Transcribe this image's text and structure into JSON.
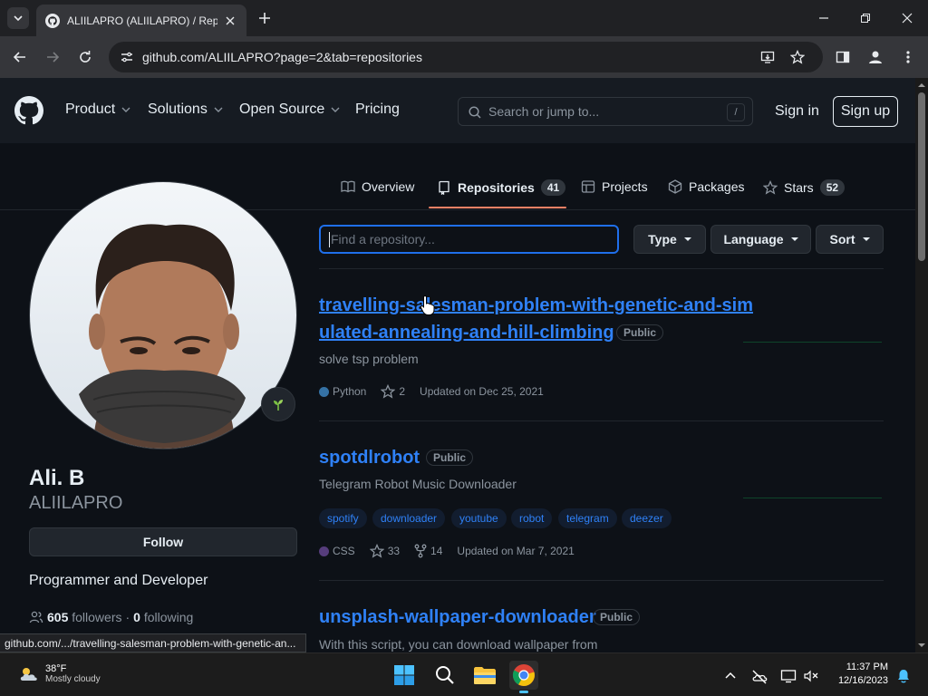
{
  "browser": {
    "tab_title": "ALIILAPRO (ALIILAPRO) / Repos",
    "url": "github.com/ALIILAPRO?page=2&tab=repositories",
    "status_url": "github.com/.../travelling-salesman-problem-with-genetic-an..."
  },
  "header": {
    "nav": [
      {
        "label": "Product"
      },
      {
        "label": "Solutions"
      },
      {
        "label": "Open Source"
      },
      {
        "label": "Pricing"
      }
    ],
    "search_placeholder": "Search or jump to...",
    "search_shortcut": "/",
    "signin": "Sign in",
    "signup": "Sign up"
  },
  "profile_tabs": {
    "overview": "Overview",
    "repositories": "Repositories",
    "repositories_count": "41",
    "projects": "Projects",
    "packages": "Packages",
    "stars": "Stars",
    "stars_count": "52"
  },
  "profile": {
    "name": "Ali. B",
    "login": "ALIILAPRO",
    "follow_label": "Follow",
    "bio": "Programmer and Developer",
    "followers_count": "605",
    "followers_label": "followers",
    "separator": "·",
    "following_count": "0",
    "following_label": "following"
  },
  "filters": {
    "find_placeholder": "Find a repository...",
    "type": "Type",
    "language": "Language",
    "sort": "Sort"
  },
  "repos": [
    {
      "name_line1": "travelling-salesman-problem-with-genetic-and-sim",
      "name_line2": "ulated-annealing-and-hill-climbing",
      "visibility": "Public",
      "description": "solve tsp problem",
      "language": "Python",
      "language_color": "#3572A5",
      "stars": "2",
      "updated": "Updated on Dec 25, 2021"
    },
    {
      "name": "spotdlrobot",
      "visibility": "Public",
      "description": "Telegram Robot Music Downloader",
      "topics": [
        "spotify",
        "downloader",
        "youtube",
        "robot",
        "telegram",
        "deezer"
      ],
      "language": "CSS",
      "language_color": "#563d7c",
      "stars": "33",
      "forks": "14",
      "updated": "Updated on Mar 7, 2021"
    },
    {
      "name": "unsplash-wallpaper-downloader",
      "visibility": "Public",
      "description": "With this script, you can download wallpaper from"
    }
  ],
  "taskbar": {
    "weather_temp": "38°F",
    "weather_desc": "Mostly cloudy",
    "time": "11:37 PM",
    "date": "12/16/2023"
  },
  "colors": {
    "link": "#2f81f7",
    "tab_accent": "#f78166",
    "focus": "#1f6feb"
  }
}
